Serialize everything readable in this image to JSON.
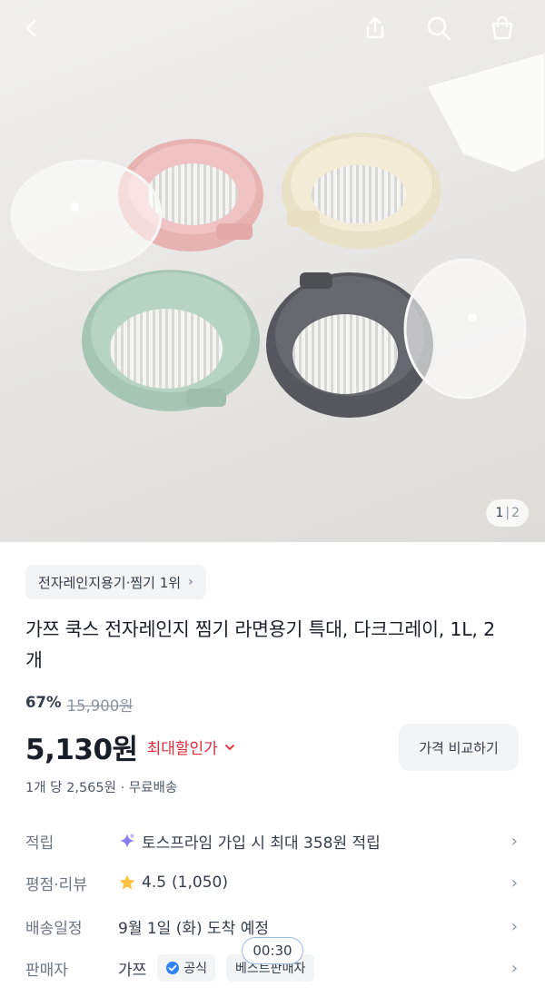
{
  "header": {
    "icons": [
      "back-icon",
      "share-icon",
      "search-icon",
      "shopping-bag-icon"
    ]
  },
  "gallery": {
    "current": "1",
    "separator": "|",
    "total": "2"
  },
  "product": {
    "rank_label": "전자레인지용기·찜기 1위",
    "title": "가쯔 쿡스 전자레인지 찜기 라면용기 특대, 다크그레이, 1L, 2개",
    "discount_percent": "67%",
    "original_price": "15,900원",
    "price": "5,130원",
    "max_discount_label": "최대할인가",
    "compare_button": "가격 비교하기",
    "unit_info": "1개 당 2,565원 · 무료배송"
  },
  "details": {
    "points": {
      "label": "적립",
      "value": "토스프라임 가입 시 최대 358원 적립"
    },
    "rating": {
      "label": "평점·리뷰",
      "score": "4.5",
      "count": "(1,050)"
    },
    "delivery": {
      "label": "배송일정",
      "value": "9월 1일 (화) 도착 예정"
    },
    "seller": {
      "label": "판매자",
      "name": "가쯔",
      "official_badge": "공식",
      "best_badge": "베스트판매자"
    }
  },
  "overlay": {
    "timer": "00:30"
  },
  "colors": {
    "accent_red": "#e42939",
    "text_primary": "#191f28",
    "text_secondary": "#6b7684",
    "chip_bg": "#f2f4f6",
    "official_blue": "#3182f6",
    "star": "#ffc342"
  }
}
